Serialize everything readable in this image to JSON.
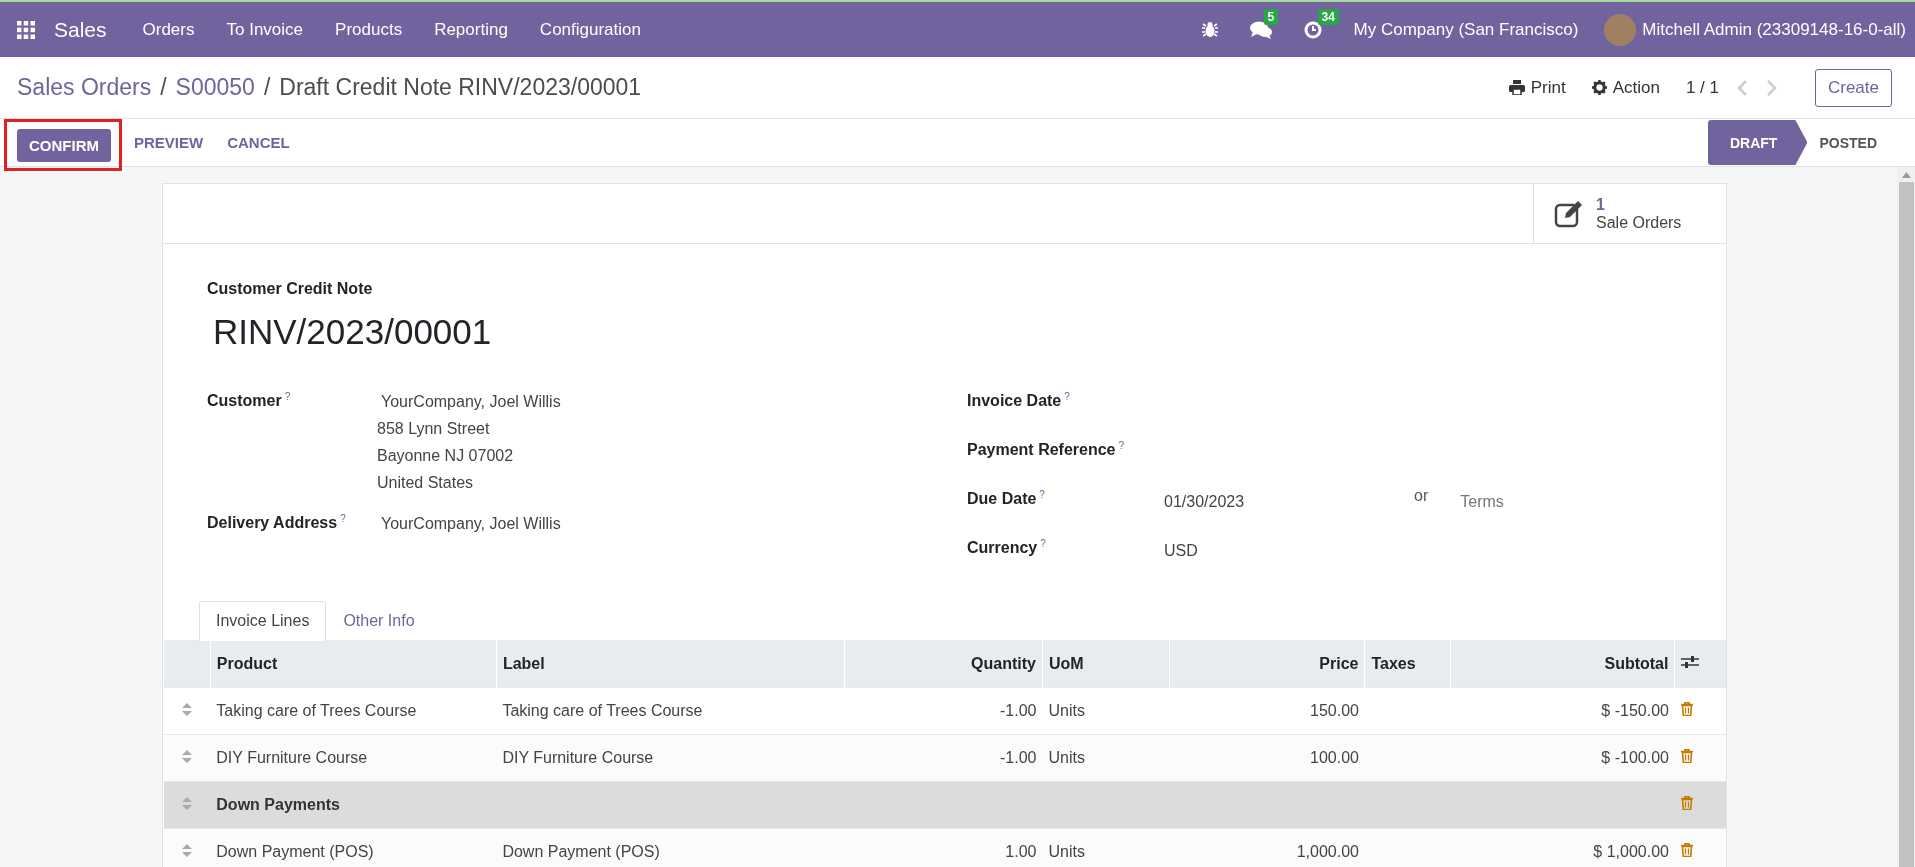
{
  "navbar": {
    "app": "Sales",
    "menus": [
      "Orders",
      "To Invoice",
      "Products",
      "Reporting",
      "Configuration"
    ],
    "messages_badge": "5",
    "activities_badge": "34",
    "company": "My Company (San Francisco)",
    "user": "Mitchell Admin (23309148-16-0-all)"
  },
  "breadcrumbs": [
    "Sales Orders",
    "S00050",
    "Draft Credit Note RINV/2023/00001"
  ],
  "breadcrumb_separators": [
    "/",
    "/"
  ],
  "control_panel": {
    "print": "Print",
    "action": "Action",
    "pager": "1 / 1",
    "create": "Create"
  },
  "actions": [
    {
      "label": "CONFIRM",
      "kind": "primary",
      "highlighted": true
    },
    {
      "label": "PREVIEW",
      "kind": "link",
      "highlighted": false
    },
    {
      "label": "CANCEL",
      "kind": "link",
      "highlighted": false
    }
  ],
  "stages": [
    {
      "label": "DRAFT",
      "selected": true
    },
    {
      "label": "POSTED",
      "selected": false
    }
  ],
  "smart_button": {
    "count": "1",
    "label": "Sale Orders"
  },
  "form": {
    "type_label": "Customer Credit Note",
    "number": "RINV/2023/00001",
    "left_fields": [
      {
        "label": "Customer",
        "help": "?",
        "lines": [
          "YourCompany, Joel Willis",
          "858 Lynn Street",
          "Bayonne NJ 07002",
          "United States"
        ]
      },
      {
        "label": "Delivery Address",
        "help": "?",
        "lines": [
          "YourCompany, Joel Willis"
        ]
      }
    ],
    "right_fields": [
      {
        "label": "Invoice Date",
        "help": "?"
      },
      {
        "label": "Payment Reference",
        "help": "?"
      },
      {
        "label": "Due Date",
        "help": "?",
        "value": "01/30/2023",
        "or": "or",
        "placeholder": "Terms"
      },
      {
        "label": "Currency",
        "help": "?",
        "value": "USD"
      }
    ]
  },
  "tabs": [
    {
      "label": "Invoice Lines",
      "selected": true
    },
    {
      "label": "Other Info",
      "selected": false
    }
  ],
  "table": {
    "columns": [
      "Product",
      "Label",
      "Quantity",
      "UoM",
      "Price",
      "Taxes",
      "Subtotal"
    ],
    "rows": [
      {
        "kind": "line",
        "product": "Taking care of Trees Course",
        "label": "Taking care of Trees Course",
        "quantity": "-1.00",
        "uom": "Units",
        "price": "150.00",
        "subtotal": "$ -150.00"
      },
      {
        "kind": "line",
        "product": "DIY Furniture Course",
        "label": "DIY Furniture Course",
        "quantity": "-1.00",
        "uom": "Units",
        "price": "100.00",
        "subtotal": "$ -100.00"
      },
      {
        "kind": "section",
        "product": "Down Payments"
      },
      {
        "kind": "line",
        "product": "Down Payment (POS)",
        "label": "Down Payment (POS)",
        "quantity": "1.00",
        "uom": "Units",
        "price": "1,000.00",
        "subtotal": "$ 1,000.00"
      }
    ]
  }
}
